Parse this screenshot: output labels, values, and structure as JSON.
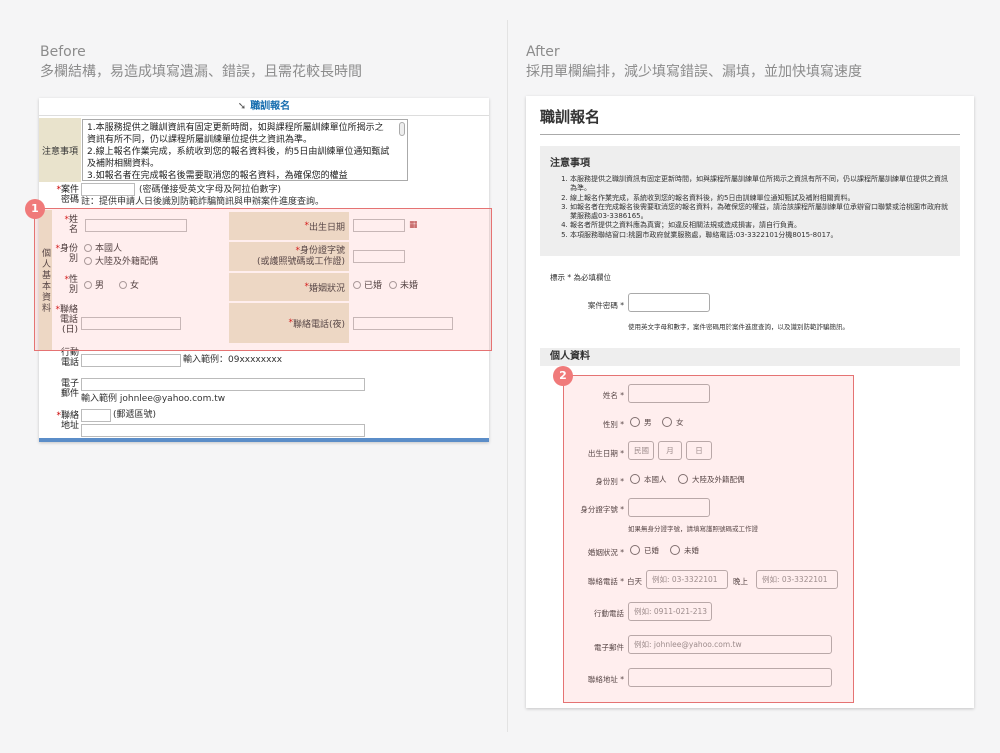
{
  "before": {
    "heading": "Before",
    "subheading": "多欄結構，易造成填寫遺漏、錯誤，且需花較長時間",
    "form_title": "職訓報名",
    "notice_label": "注意事項",
    "notice_lines": [
      "1.本服務提供之職訓資訊有固定更新時間，如與課程所屬訓練單位所揭示之資訊有所不同，仍以課程所屬訓練單位提供之資訊為準。",
      "2.線上報名作業完成，系統收到您的報名資料後，約5日由訓練單位通知甄試及補附相關資料。",
      "3.如報名者在完成報名後需要取消您的報名資料，為確保您的權益"
    ],
    "case_label": "案件",
    "case_label2": "密碼",
    "case_hint": "(密碼僅接受英文字母及阿拉伯數字)",
    "case_note": "註：提供申請人日後識別防範詐騙簡訊與申辦案件進度查詢。",
    "section_label": "個人基本資料",
    "name_label_a": "姓",
    "name_label_b": "名",
    "dob_label": "出生日期",
    "identity_label_a": "身份",
    "identity_label_b": "別",
    "identity_opt1": "本國人",
    "identity_opt2": "大陸及外籍配偶",
    "id_label": "身份證字號",
    "id_label2": "(或護照號碼或工作證)",
    "gender_label_a": "性",
    "gender_label_b": "別",
    "gender_male": "男",
    "gender_female": "女",
    "marital_label": "婚姻狀況",
    "marital_opt1": "已婚",
    "marital_opt2": "未婚",
    "phone_label_a": "聯絡",
    "phone_label_b": "電話",
    "phone_label_c": "(日)",
    "phone_night_label": "聯絡電話(夜)",
    "mobile_label_a": "行動",
    "mobile_label_b": "電話",
    "mobile_hint": "輸入範例：09xxxxxxxx",
    "email_label_a": "電子",
    "email_label_b": "郵件",
    "email_hint": "輸入範例 johnlee@yahoo.com.tw",
    "addr_label_a": "聯絡",
    "addr_label_b": "地址",
    "zip_hint": "(郵遞區號)",
    "badge": "1"
  },
  "after": {
    "heading": "After",
    "subheading": "採用單欄編排，減少填寫錯誤、漏填，並加快填寫速度",
    "form_title": "職訓報名",
    "notice_title": "注意事項",
    "notice_items": [
      "本服務提供之職訓資訊有固定更新時間，如與課程所屬訓練單位所揭示之資訊有所不同，仍以課程所屬訓練單位提供之資訊為準。",
      "線上報名作業完成，系統收到您的報名資料後，約5日由訓練單位通知甄試及補附相關資料。",
      "如報名者在完成報名後需要取消您的報名資料，為確保您的權益，請洽該課程所屬訓練單位承辦窗口聯繫或洽桃園市政府就業服務處03-3386165。",
      "報名者所提供之資料應為真實；如違反相關法規或造成損害，請自行負責。",
      "本項服務聯絡窗口:桃園市政府就業服務處，聯絡電話:03-3322101分機8015-8017。"
    ],
    "required_note": "標示 * 為必填欄位",
    "case_label": "案件密碼 *",
    "case_hint": "使用英文字母和數字，案件密碼用於案件進度查詢，以及識別防範詐騙簡訊。",
    "section_title": "個人資料",
    "name_label": "姓名 *",
    "gender_label": "性別 *",
    "gender_male": "男",
    "gender_female": "女",
    "dob_label": "出生日期 *",
    "dob_year": "民國",
    "dob_month": "月",
    "dob_day": "日",
    "identity_label": "身份別 *",
    "identity_opt1": "本國人",
    "identity_opt2": "大陸及外籍配偶",
    "id_label": "身分證字號 *",
    "id_hint": "如果無身分證字號，請填寫護照號碼或工作證",
    "marital_label": "婚姻狀況 *",
    "marital_opt1": "已婚",
    "marital_opt2": "未婚",
    "phone_label": "聯絡電話 *",
    "day_label": "白天",
    "day_placeholder": "例如: 03-3322101",
    "night_label": "晚上",
    "night_placeholder": "例如: 03-3322101",
    "mobile_label": "行動電話",
    "mobile_placeholder": "例如: 0911-021-213",
    "email_label": "電子郵件",
    "email_placeholder": "例如: johnlee@yahoo.com.tw",
    "addr_label": "聯絡地址 *",
    "badge": "2"
  },
  "colors": {
    "highlight": "#e57373",
    "badge": "#f07a7a",
    "old_label_bg": "#e9e3cc",
    "title_blue": "#1a6fb0"
  }
}
